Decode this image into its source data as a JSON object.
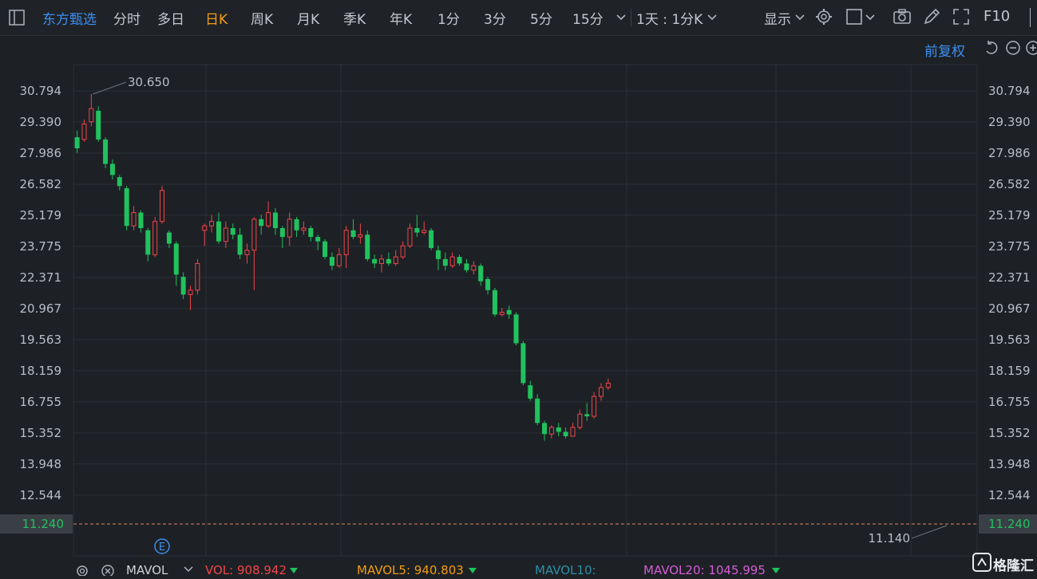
{
  "toolbar": {
    "stock_name": "东方甄选",
    "tabs": [
      "分时",
      "多日",
      "日K",
      "周K",
      "月K",
      "季K",
      "年K",
      "1分",
      "3分",
      "5分",
      "15分"
    ],
    "active_tab": "日K",
    "interval_select": "1天 : 1分K",
    "display_label": "显示",
    "f10_label": "F10",
    "adjust_label": "前复权"
  },
  "chart_data": {
    "type": "candlestick",
    "y_ticks": [
      "30.794",
      "29.390",
      "27.986",
      "26.582",
      "25.179",
      "23.775",
      "22.371",
      "20.967",
      "19.563",
      "18.159",
      "16.755",
      "15.352",
      "13.948",
      "12.544"
    ],
    "ylim": [
      11.24,
      30.794
    ],
    "current_price": "11.240",
    "high_label": "30.650",
    "low_label": "11.140",
    "event_marker": "E",
    "candles": [
      [
        28.7,
        28.2,
        29.0,
        28.0
      ],
      [
        28.6,
        29.3,
        29.5,
        28.5
      ],
      [
        29.4,
        30.0,
        30.65,
        29.2
      ],
      [
        29.9,
        28.6,
        30.1,
        28.5
      ],
      [
        28.6,
        27.5,
        28.7,
        27.3
      ],
      [
        27.5,
        27.0,
        27.7,
        26.8
      ],
      [
        26.9,
        26.5,
        27.0,
        26.3
      ],
      [
        26.4,
        24.7,
        26.5,
        24.5
      ],
      [
        24.7,
        25.3,
        25.6,
        24.5
      ],
      [
        25.3,
        24.6,
        25.4,
        24.4
      ],
      [
        24.5,
        23.4,
        24.6,
        23.1
      ],
      [
        23.4,
        24.9,
        25.1,
        23.3
      ],
      [
        24.9,
        26.3,
        26.5,
        24.8
      ],
      [
        24.4,
        23.9,
        24.5,
        23.7
      ],
      [
        23.9,
        22.5,
        24.0,
        22.0
      ],
      [
        22.4,
        21.6,
        22.6,
        21.4
      ],
      [
        21.6,
        21.8,
        22.0,
        20.9
      ],
      [
        21.8,
        23.0,
        23.2,
        21.6
      ],
      [
        24.5,
        24.7,
        24.8,
        23.8
      ],
      [
        24.7,
        24.9,
        25.2,
        24.4
      ],
      [
        24.9,
        24.0,
        25.3,
        23.9
      ],
      [
        24.0,
        24.6,
        24.9,
        23.7
      ],
      [
        24.6,
        24.3,
        24.8,
        24.1
      ],
      [
        24.3,
        23.4,
        24.6,
        23.2
      ],
      [
        23.4,
        23.6,
        23.9,
        23.0
      ],
      [
        23.6,
        25.0,
        25.1,
        21.8
      ],
      [
        25.0,
        24.7,
        25.2,
        24.3
      ],
      [
        24.7,
        25.3,
        25.8,
        24.6
      ],
      [
        25.3,
        24.6,
        25.5,
        24.3
      ],
      [
        24.6,
        24.2,
        24.7,
        23.7
      ],
      [
        24.2,
        25.0,
        25.3,
        23.8
      ],
      [
        25.0,
        24.5,
        25.1,
        24.2
      ],
      [
        24.5,
        24.6,
        24.9,
        24.3
      ],
      [
        24.6,
        24.2,
        24.7,
        24.0
      ],
      [
        24.2,
        24.0,
        24.3,
        23.6
      ],
      [
        24.0,
        23.3,
        24.1,
        23.2
      ],
      [
        23.3,
        22.9,
        23.5,
        22.7
      ],
      [
        22.9,
        23.4,
        23.7,
        22.8
      ],
      [
        23.4,
        24.5,
        24.7,
        22.8
      ],
      [
        24.5,
        24.2,
        25.0,
        24.1
      ],
      [
        24.2,
        24.3,
        24.8,
        23.9
      ],
      [
        24.3,
        23.2,
        24.5,
        23.1
      ],
      [
        23.2,
        23.0,
        23.4,
        22.8
      ],
      [
        23.0,
        23.2,
        23.4,
        22.6
      ],
      [
        23.2,
        23.0,
        23.5,
        22.9
      ],
      [
        23.0,
        23.3,
        23.6,
        22.9
      ],
      [
        23.3,
        23.8,
        24.0,
        23.2
      ],
      [
        23.8,
        24.6,
        24.8,
        23.7
      ],
      [
        24.6,
        24.4,
        25.2,
        24.2
      ],
      [
        24.4,
        24.5,
        24.9,
        24.3
      ],
      [
        24.5,
        23.7,
        24.6,
        23.6
      ],
      [
        23.6,
        23.2,
        23.8,
        22.7
      ],
      [
        23.2,
        22.9,
        23.5,
        22.7
      ],
      [
        22.9,
        23.3,
        23.5,
        22.8
      ],
      [
        23.3,
        23.0,
        23.4,
        22.9
      ],
      [
        23.0,
        22.7,
        23.2,
        22.6
      ],
      [
        22.7,
        22.9,
        23.1,
        22.5
      ],
      [
        22.9,
        22.2,
        23.0,
        22.0
      ],
      [
        22.3,
        21.8,
        22.4,
        21.6
      ],
      [
        21.8,
        20.7,
        21.9,
        20.6
      ],
      [
        20.7,
        20.8,
        21.0,
        20.6
      ],
      [
        20.9,
        20.7,
        21.1,
        20.5
      ],
      [
        20.7,
        19.4,
        20.8,
        19.3
      ],
      [
        19.4,
        17.6,
        19.5,
        17.5
      ],
      [
        17.5,
        16.9,
        17.7,
        16.8
      ],
      [
        16.9,
        15.8,
        17.1,
        15.7
      ],
      [
        15.8,
        15.3,
        15.9,
        15.0
      ],
      [
        15.3,
        15.6,
        15.7,
        15.1
      ],
      [
        15.6,
        15.4,
        15.8,
        15.2
      ],
      [
        15.4,
        15.2,
        15.6,
        15.1
      ],
      [
        15.2,
        15.6,
        15.8,
        15.2
      ],
      [
        15.6,
        16.2,
        16.4,
        15.5
      ],
      [
        16.2,
        16.1,
        16.7,
        15.9
      ],
      [
        16.1,
        17.0,
        17.2,
        16.0
      ],
      [
        17.0,
        17.4,
        17.6,
        16.8
      ],
      [
        17.4,
        17.6,
        17.8,
        17.3
      ]
    ]
  },
  "indicators": {
    "name": "MAVOL",
    "vol_label": "VOL: 908.942",
    "mavol5_label": "MAVOL5: 940.803",
    "mavol10_label": "MAVOL10:",
    "mavol20_label": "MAVOL20: 1045.995"
  },
  "colors": {
    "up": "#f0454a",
    "down": "#21c25e",
    "grid": "#2b3037",
    "price_line": "#e0825a"
  },
  "watermark": "格隆汇"
}
